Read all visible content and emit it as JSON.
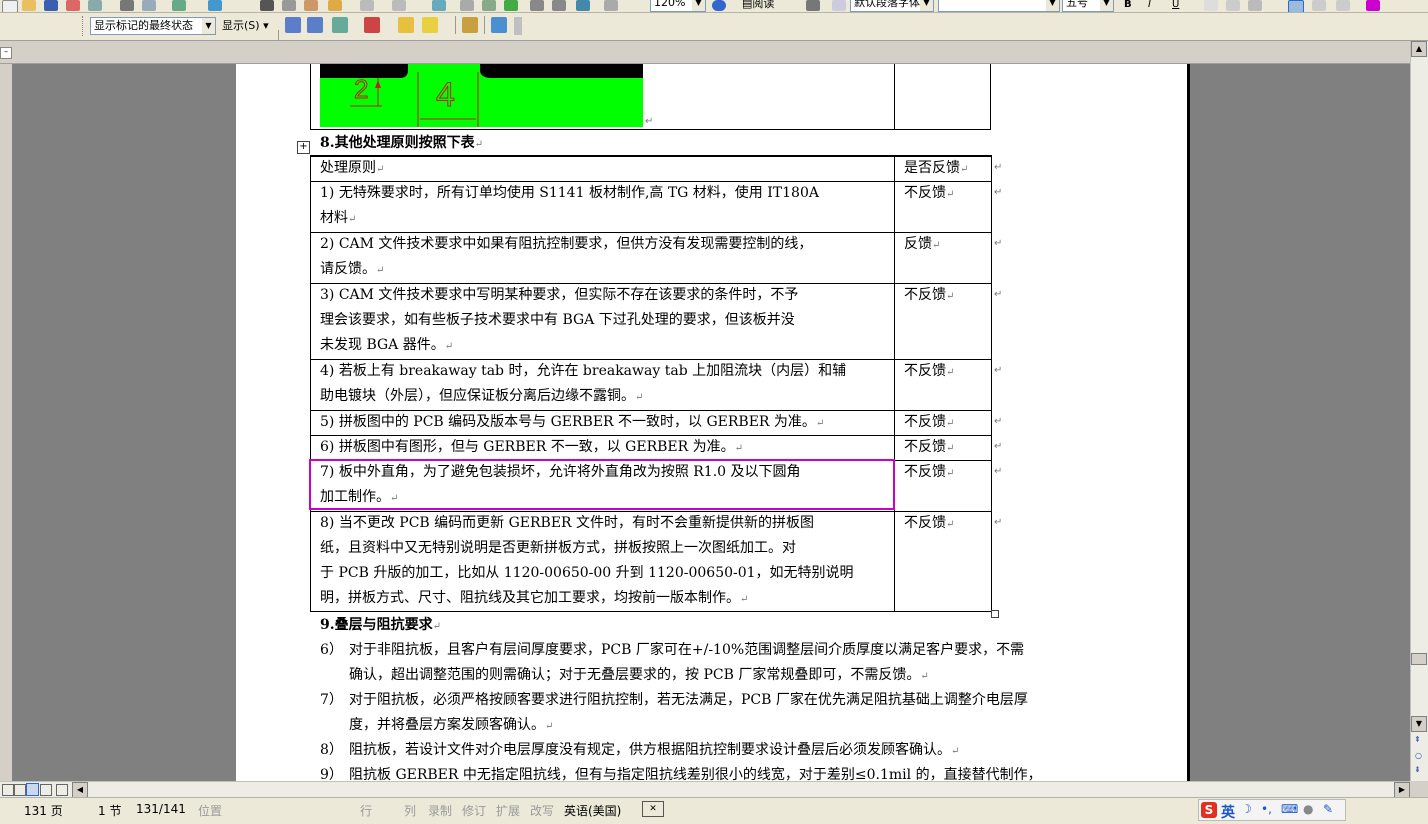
{
  "toolbar": {
    "zoom": "120%",
    "read_label": "阅读",
    "style": "默认段落字体",
    "font_size": "五号",
    "markup_view": "显示标记的最终状态",
    "show_label": "显示(S)"
  },
  "document": {
    "section8_title": "8.其他处理原则按照下表",
    "table_header": {
      "principle": "处理原则",
      "feedback": "是否反馈"
    },
    "rows": [
      {
        "lines": [
          "1) 无特殊要求时，所有订单均使用 S1141 板材制作,高 TG 材料，使用 IT180A",
          "材料"
        ],
        "feedback": "不反馈"
      },
      {
        "lines": [
          "2) CAM 文件技术要求中如果有阻抗控制要求，但供方没有发现需要控制的线，",
          "请反馈。"
        ],
        "feedback": "反馈"
      },
      {
        "lines": [
          "3) CAM 文件技术要求中写明某种要求，但实际不存在该要求的条件时，不予",
          "理会该要求，如有些板子技术要求中有 BGA 下过孔处理的要求，但该板并没",
          "未发现 BGA 器件。"
        ],
        "feedback": "不反馈"
      },
      {
        "lines": [
          "4) 若板上有 breakaway tab 时，允许在 breakaway tab 上加阻流块（内层）和辅",
          "助电镀块（外层），但应保证板分离后边缘不露铜。"
        ],
        "feedback": "不反馈"
      },
      {
        "lines": [
          "5) 拼板图中的 PCB 编码及版本号与 GERBER 不一致时，以 GERBER 为准。"
        ],
        "feedback": "不反馈"
      },
      {
        "lines": [
          "6) 拼板图中有图形，但与 GERBER 不一致，以 GERBER 为准。"
        ],
        "feedback": "不反馈"
      },
      {
        "lines": [
          "7) 板中外直角，为了避免包装损坏，允许将外直角改为按照 R1.0 及以下圆角",
          "加工制作。"
        ],
        "feedback": "不反馈"
      },
      {
        "lines": [
          "8) 当不更改 PCB 编码而更新 GERBER 文件时，有时不会重新提供新的拼板图",
          "纸，且资料中又无特别说明是否更新拼板方式，拼板按照上一次图纸加工。对",
          "于 PCB 升版的加工，比如从 1120-00650-00 升到 1120-00650-01，如无特别说明",
          "明，拼板方式、尺寸、阻抗线及其它加工要求，均按前一版本制作。"
        ],
        "feedback": "不反馈"
      }
    ],
    "section9_title": "9.叠层与阻抗要求",
    "section9_items": [
      {
        "num": "6）",
        "lines": [
          "对于非阻抗板，且客户有层间厚度要求，PCB 厂家可在+/-10%范围调整层间介质厚度以满足客户要求，不需",
          "确认，超出调整范围的则需确认；对于无叠层要求的，按 PCB 厂家常规叠即可，不需反馈。"
        ]
      },
      {
        "num": "7）",
        "lines": [
          "对于阻抗板，必须严格按顾客要求进行阻抗控制，若无法满足，PCB 厂家在优先满足阻抗基础上调整介电层厚",
          "度，并将叠层方案发顾客确认。"
        ]
      },
      {
        "num": "8）",
        "lines": [
          "阻抗板，若设计文件对介电层厚度没有规定，供方根据阻抗控制要求设计叠层后必须发顾客确认。"
        ]
      },
      {
        "num": "9）",
        "lines": [
          "阻抗板 GERBER 中无指定阻抗线，但有与指定阻抗线差别很小的线宽，对于差别≤0.1mil 的，直接替代制作，"
        ]
      }
    ],
    "figure_labels": {
      "a": "2",
      "b": "4"
    }
  },
  "status": {
    "page": "131 页",
    "section": "1 节",
    "page_of": "131/141",
    "position": "位置",
    "line": "行",
    "col": "列",
    "rec": "录制",
    "trk": "修订",
    "ext": "扩展",
    "ovr": "改写",
    "language": "英语(美国)"
  },
  "ime": {
    "label": "英"
  },
  "colors": {
    "highlight": "#cc00cc",
    "figure_green": "#00ff00",
    "page_bg": "#808080"
  }
}
